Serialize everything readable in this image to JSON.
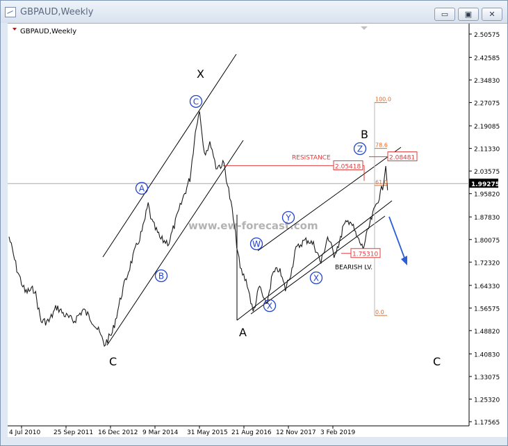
{
  "window": {
    "title": "GBPAUD,Weekly",
    "controls": {
      "minimize": "▭",
      "restore": "▣",
      "close": "✕"
    }
  },
  "chart_data": {
    "type": "line",
    "symbol_label": "GBPAUD,Weekly",
    "current_price": "1.99275",
    "y_ticks": [
      "2.50575",
      "2.42585",
      "2.34830",
      "2.27075",
      "2.19085",
      "2.11330",
      "2.03575",
      "1.95820",
      "1.87830",
      "1.80075",
      "1.72320",
      "1.64330",
      "1.56575",
      "1.48820",
      "1.40830",
      "1.33075",
      "1.25320",
      "1.17565"
    ],
    "y_range": [
      1.17565,
      2.50575
    ],
    "x_ticks": [
      "4 Jul 2010",
      "25 Sep 2011",
      "16 Dec 2012",
      "9 Mar 2014",
      "31 May 2015",
      "21 Aug 2016",
      "12 Nov 2017",
      "3 Feb 2019"
    ],
    "x_range": [
      "2010-07-04",
      "2020-06-01"
    ],
    "price_series": [
      [
        "2010-07-04",
        1.81
      ],
      [
        "2010-09-15",
        1.7
      ],
      [
        "2010-12-01",
        1.62
      ],
      [
        "2011-03-01",
        1.63
      ],
      [
        "2011-05-01",
        1.52
      ],
      [
        "2011-07-15",
        1.52
      ],
      [
        "2011-09-25",
        1.57
      ],
      [
        "2011-12-15",
        1.54
      ],
      [
        "2012-03-01",
        1.52
      ],
      [
        "2012-06-01",
        1.56
      ],
      [
        "2012-09-01",
        1.52
      ],
      [
        "2012-11-01",
        1.48
      ],
      [
        "2012-12-16",
        1.44
      ],
      [
        "2013-03-01",
        1.48
      ],
      [
        "2013-06-01",
        1.62
      ],
      [
        "2013-09-01",
        1.73
      ],
      [
        "2013-12-15",
        1.84
      ],
      [
        "2014-02-01",
        1.92
      ],
      [
        "2014-03-09",
        1.86
      ],
      [
        "2014-06-01",
        1.8
      ],
      [
        "2014-08-15",
        1.79
      ],
      [
        "2014-10-15",
        1.86
      ],
      [
        "2015-01-01",
        1.95
      ],
      [
        "2015-03-01",
        2.01
      ],
      [
        "2015-05-01",
        2.2
      ],
      [
        "2015-05-31",
        2.24
      ],
      [
        "2015-07-15",
        2.1
      ],
      [
        "2015-09-15",
        2.13
      ],
      [
        "2015-11-01",
        2.05
      ],
      [
        "2016-01-15",
        2.06
      ],
      [
        "2016-04-01",
        1.9
      ],
      [
        "2016-06-15",
        1.7
      ],
      [
        "2016-08-21",
        1.65
      ],
      [
        "2016-10-15",
        1.55
      ],
      [
        "2016-12-15",
        1.64
      ],
      [
        "2017-02-15",
        1.57
      ],
      [
        "2017-04-15",
        1.68
      ],
      [
        "2017-06-15",
        1.7
      ],
      [
        "2017-08-15",
        1.63
      ],
      [
        "2017-10-15",
        1.7
      ],
      [
        "2017-11-12",
        1.76
      ],
      [
        "2018-01-15",
        1.79
      ],
      [
        "2018-03-15",
        1.8
      ],
      [
        "2018-05-15",
        1.78
      ],
      [
        "2018-07-15",
        1.72
      ],
      [
        "2018-09-15",
        1.81
      ],
      [
        "2018-11-15",
        1.75
      ],
      [
        "2019-01-15",
        1.8
      ],
      [
        "2019-02-03",
        1.84
      ],
      [
        "2019-04-15",
        1.87
      ],
      [
        "2019-06-15",
        1.81
      ],
      [
        "2019-08-15",
        1.77
      ],
      [
        "2019-10-15",
        1.85
      ],
      [
        "2019-12-15",
        1.92
      ],
      [
        "2020-02-15",
        1.98
      ],
      [
        "2020-03-15",
        2.06
      ],
      [
        "2020-04-01",
        1.97
      ]
    ],
    "wave_labels": [
      "X",
      "C",
      "A",
      "B",
      "C"
    ],
    "circle_labels": [
      "A",
      "B",
      "C",
      "W",
      "X",
      "Y",
      "X",
      "Z"
    ],
    "fib_levels": [
      {
        "label": "100.0",
        "price": 2.2707
      },
      {
        "label": "78.6",
        "price": 2.1133
      },
      {
        "label": "61.0",
        "price": 1.986
      },
      {
        "label": "0.0",
        "price": 1.54
      }
    ],
    "resistance": {
      "text": "RESISTANCE",
      "price_label": "2.05418",
      "price": 2.0542
    },
    "target_label": {
      "text": "2.08481",
      "price": 2.0848
    },
    "bearish": {
      "text": "BEARISH LV.",
      "price_label": "1.75310",
      "price": 1.7531
    },
    "watermark": "www.ew-forecast.com",
    "colors": {
      "price": "#1a1a1a",
      "annotation": "#e03b3b",
      "fib": "#e06a2a",
      "circle": "#2244cc",
      "arrow": "#2a5fd6",
      "current": "#000000"
    }
  }
}
